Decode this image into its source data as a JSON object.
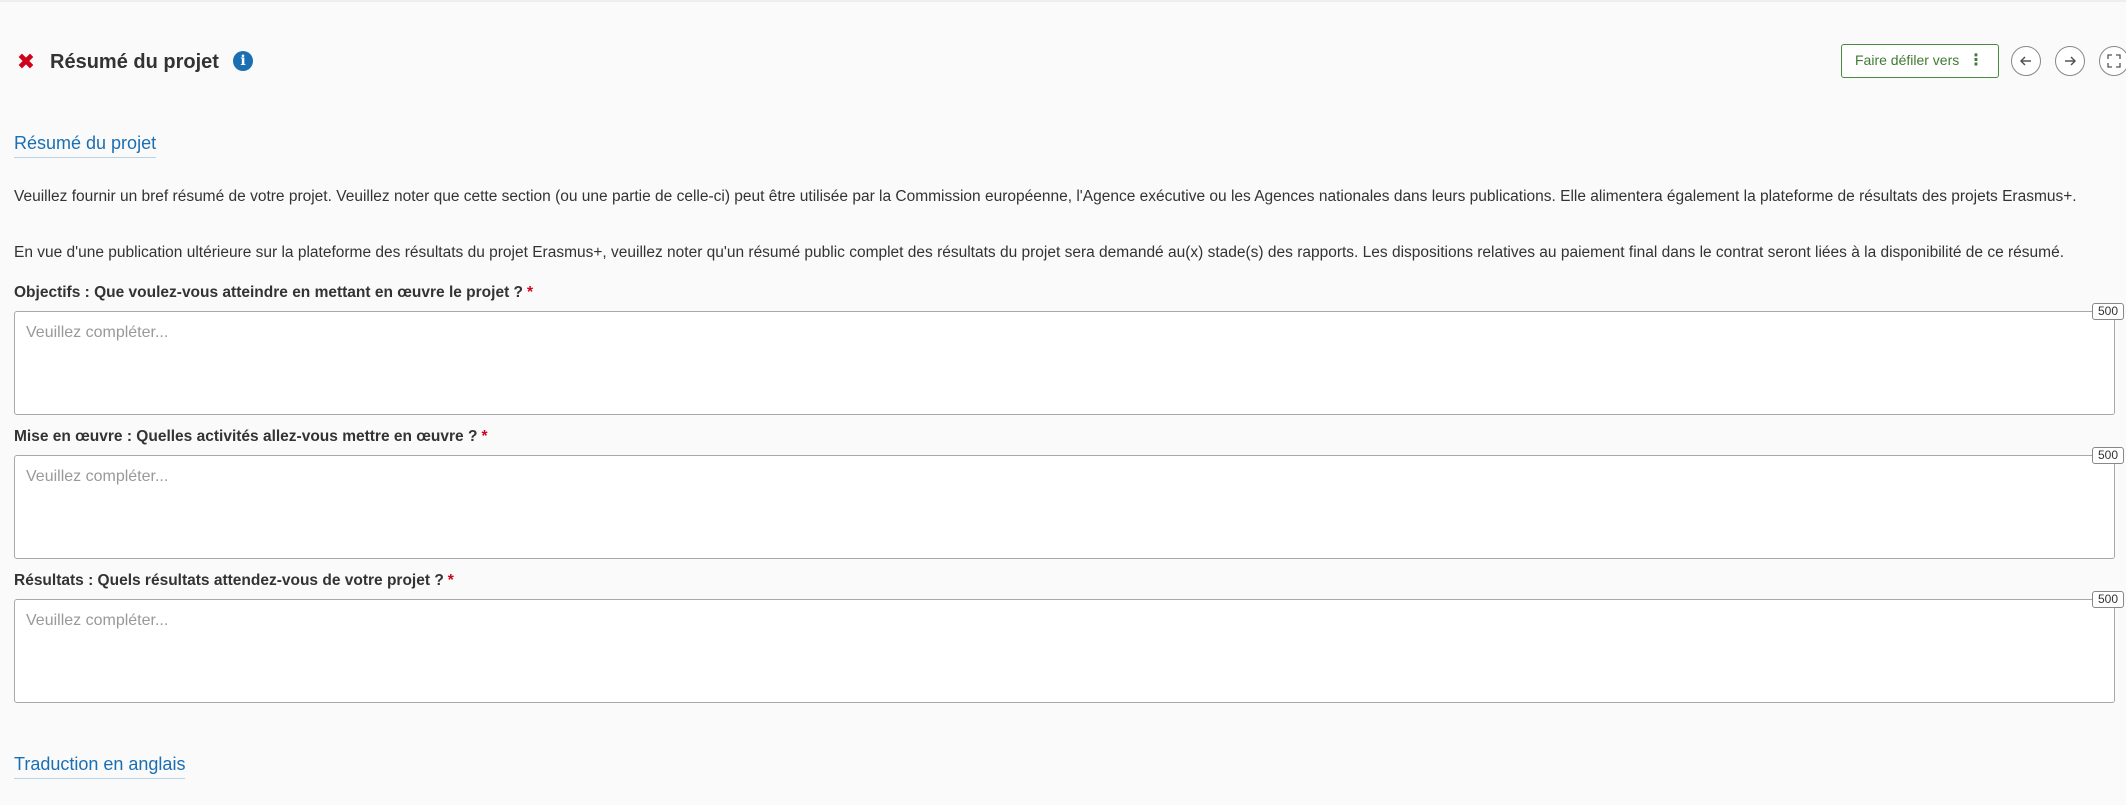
{
  "header": {
    "title": "Résumé du projet",
    "scroll_to_label": "Faire défiler vers"
  },
  "section": {
    "link": "Résumé du projet",
    "paragraph1": "Veuillez fournir un bref résumé de votre projet. Veuillez noter que cette section (ou une partie de celle-ci) peut être utilisée par la Commission européenne, l'Agence exécutive ou les Agences nationales dans leurs publications. Elle alimentera également la plateforme de résultats des projets Erasmus+.",
    "paragraph2": "En vue d'une publication ultérieure sur la plateforme des résultats du projet Erasmus+, veuillez noter qu'un résumé public complet des résultats du projet sera demandé au(x) stade(s) des rapports. Les dispositions relatives au paiement final dans le contrat seront liées à la disponibilité de ce résumé."
  },
  "fields": [
    {
      "label": "Objectifs : Que voulez-vous atteindre en mettant en œuvre le projet ?",
      "required": "*",
      "placeholder": "Veuillez compléter...",
      "value": "",
      "counter": "500"
    },
    {
      "label": "Mise en œuvre : Quelles activités allez-vous mettre en œuvre ?",
      "required": "*",
      "placeholder": "Veuillez compléter...",
      "value": "",
      "counter": "500"
    },
    {
      "label": "Résultats : Quels résultats attendez-vous de votre projet ?",
      "required": "*",
      "placeholder": "Veuillez compléter...",
      "value": "",
      "counter": "500"
    }
  ],
  "next_section": {
    "link": "Traduction en anglais"
  },
  "colors": {
    "accent_blue": "#1a6fb3",
    "required_red": "#d0021b",
    "button_green": "#3f7a34"
  }
}
